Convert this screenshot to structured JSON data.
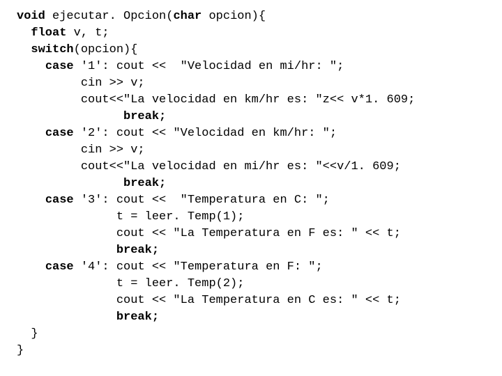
{
  "code": {
    "lines": [
      [
        {
          "t": "void",
          "kw": true
        },
        {
          "t": " ejecutar. Opcion("
        },
        {
          "t": "char",
          "kw": true
        },
        {
          "t": " opcion){"
        }
      ],
      [
        {
          "t": "  "
        },
        {
          "t": "float",
          "kw": true
        },
        {
          "t": " v, t;"
        }
      ],
      [
        {
          "t": "  "
        },
        {
          "t": "switch",
          "kw": true
        },
        {
          "t": "(opcion){"
        }
      ],
      [
        {
          "t": "    "
        },
        {
          "t": "case",
          "kw": true
        },
        {
          "t": " '1': cout <<  \"Velocidad en mi/hr: \";"
        }
      ],
      [
        {
          "t": "         cin >> v;"
        }
      ],
      [
        {
          "t": "         cout<<\"La velocidad en km/hr es: \"z<< v*1. 609;"
        }
      ],
      [
        {
          "t": "               "
        },
        {
          "t": "break;",
          "kw": true
        }
      ],
      [
        {
          "t": "    "
        },
        {
          "t": "case",
          "kw": true
        },
        {
          "t": " '2': cout << \"Velocidad en km/hr: \";"
        }
      ],
      [
        {
          "t": "         cin >> v;"
        }
      ],
      [
        {
          "t": "         cout<<\"La velocidad en mi/hr es: \"<<v/1. 609;"
        }
      ],
      [
        {
          "t": "               "
        },
        {
          "t": "break;",
          "kw": true
        }
      ],
      [
        {
          "t": "    "
        },
        {
          "t": "case",
          "kw": true
        },
        {
          "t": " '3': cout <<  \"Temperatura en C: \";"
        }
      ],
      [
        {
          "t": "              t = leer. Temp(1);"
        }
      ],
      [
        {
          "t": "              cout << \"La Temperatura en F es: \" << t;"
        }
      ],
      [
        {
          "t": "              "
        },
        {
          "t": "break;",
          "kw": true
        }
      ],
      [
        {
          "t": "    "
        },
        {
          "t": "case",
          "kw": true
        },
        {
          "t": " '4': cout << \"Temperatura en F: \";"
        }
      ],
      [
        {
          "t": "              t = leer. Temp(2);"
        }
      ],
      [
        {
          "t": "              cout << \"La Temperatura en C es: \" << t;"
        }
      ],
      [
        {
          "t": "              "
        },
        {
          "t": "break;",
          "kw": true
        }
      ],
      [
        {
          "t": "  }"
        }
      ],
      [
        {
          "t": "}"
        }
      ]
    ]
  }
}
